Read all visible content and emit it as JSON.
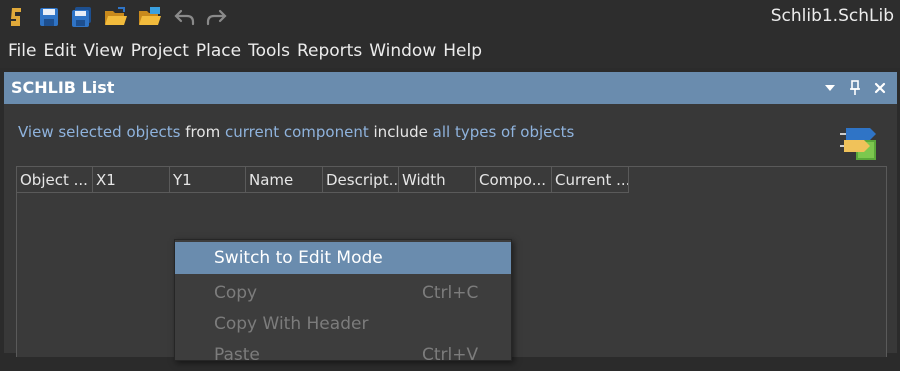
{
  "titlebar": {
    "app_title": "Schlib1.SchLib",
    "icons": [
      "app-logo-icon",
      "save-icon",
      "save-all-icon",
      "open-folder-icon",
      "open-project-icon",
      "undo-icon",
      "redo-icon"
    ]
  },
  "menubar": {
    "items": [
      "File",
      "Edit",
      "View",
      "Project",
      "Place",
      "Tools",
      "Reports",
      "Window",
      "Help"
    ]
  },
  "panel": {
    "title": "SCHLIB List",
    "filter": {
      "view_link": "View selected objects",
      "from_text": "from",
      "scope_link": "current component",
      "include_text": "include",
      "types_link": "all types of objects"
    },
    "columns": [
      "Object ...",
      "X1",
      "Y1",
      "Name",
      "Descript...",
      "Width",
      "Compo...",
      "Current ..."
    ]
  },
  "context_menu": {
    "items": [
      {
        "label": "Switch to Edit Mode",
        "shortcut": "",
        "state": "highlighted"
      },
      {
        "label": "Copy",
        "shortcut": "Ctrl+C",
        "state": "disabled"
      },
      {
        "label": "Copy With Header",
        "shortcut": "",
        "state": "disabled"
      },
      {
        "label": "Paste",
        "shortcut": "Ctrl+V",
        "state": "disabled"
      }
    ]
  },
  "colors": {
    "accent": "#6a8cae",
    "link": "#8fb3dd",
    "background": "#2b2b2b"
  }
}
